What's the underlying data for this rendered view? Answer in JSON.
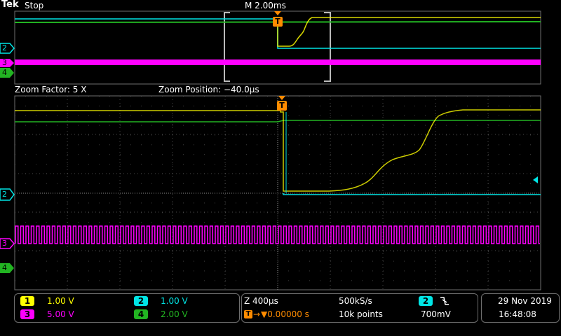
{
  "header": {
    "brand": "Tek",
    "run_state": "Stop",
    "timebase": "M 2.00ms"
  },
  "zoom": {
    "factor": "Zoom Factor: 5 X",
    "position": "Zoom Position: −40.0µs"
  },
  "trigger": {
    "marker": "T"
  },
  "channel_markers": [
    "2",
    "3",
    "4"
  ],
  "channels": [
    {
      "id": "1",
      "scale": "1.00 V",
      "color": "#ffff00"
    },
    {
      "id": "2",
      "scale": "1.00 V",
      "color": "#00e5e5"
    },
    {
      "id": "3",
      "scale": "5.00 V",
      "color": "#ff00ff"
    },
    {
      "id": "4",
      "scale": "2.00 V",
      "color": "#22b422"
    }
  ],
  "horizontal": {
    "zoom_scale": "Z 400µs",
    "sample_rate": "500kS/s",
    "trigger_position": "▼0.00000 s",
    "record_length": "10k points"
  },
  "trigger_info": {
    "source": "2",
    "slope_icon": "falling-edge-icon",
    "level": "700mV"
  },
  "datetime": {
    "date": "29 Nov 2019",
    "time": "16:48:08"
  }
}
